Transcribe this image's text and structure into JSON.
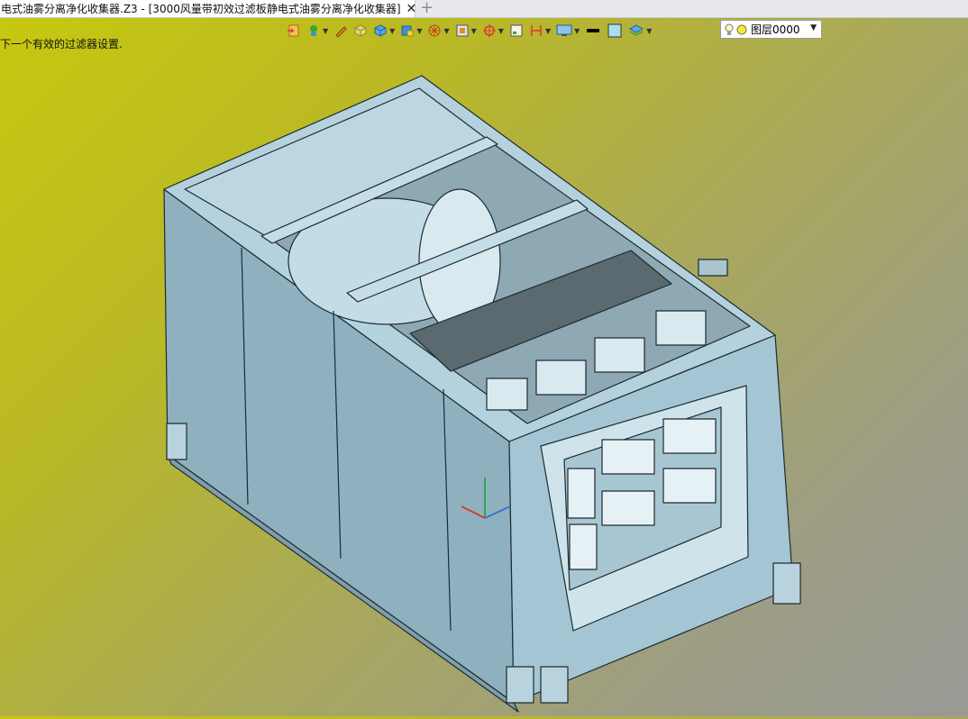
{
  "tab": {
    "title": "电式油雾分离净化收集器.Z3 - [3000风量带初效过滤板静电式油雾分离净化收集器]",
    "close_icon": "close-icon",
    "add_icon": "plus-icon"
  },
  "toolbar": {
    "items": [
      {
        "name": "orange-page-icon"
      },
      {
        "name": "green-plant-icon"
      },
      {
        "name": "pencil-icon"
      },
      {
        "name": "yellow-cube-icon"
      },
      {
        "name": "blue-cube-icon"
      },
      {
        "name": "blue-cube-alt-icon"
      },
      {
        "name": "orange-wheel-icon"
      },
      {
        "name": "view-box-icon"
      },
      {
        "name": "red-target-icon"
      },
      {
        "name": "square-icon"
      },
      {
        "name": "red-frame-icon"
      },
      {
        "name": "monitor-icon"
      },
      {
        "name": "line-weight-icon"
      },
      {
        "name": "color-swatch-icon"
      },
      {
        "name": "layers-stack-icon"
      }
    ],
    "accent_colors": {
      "orange": "#e68a1e",
      "blue": "#3c8fd6",
      "red": "#d83a2a",
      "green": "#3aa53a",
      "swatch": "#a8dff0"
    }
  },
  "layer_selector": {
    "label": "图层0000",
    "bulb_icon": "bulb-icon",
    "dot_icon": "yellow-dot-icon"
  },
  "status_hint": "下一个有效的过滤器设置.",
  "viewport": {
    "model_color": "#a9cbd9",
    "background_top": "#c7c80f",
    "background_bottom": "#9a9a96"
  }
}
